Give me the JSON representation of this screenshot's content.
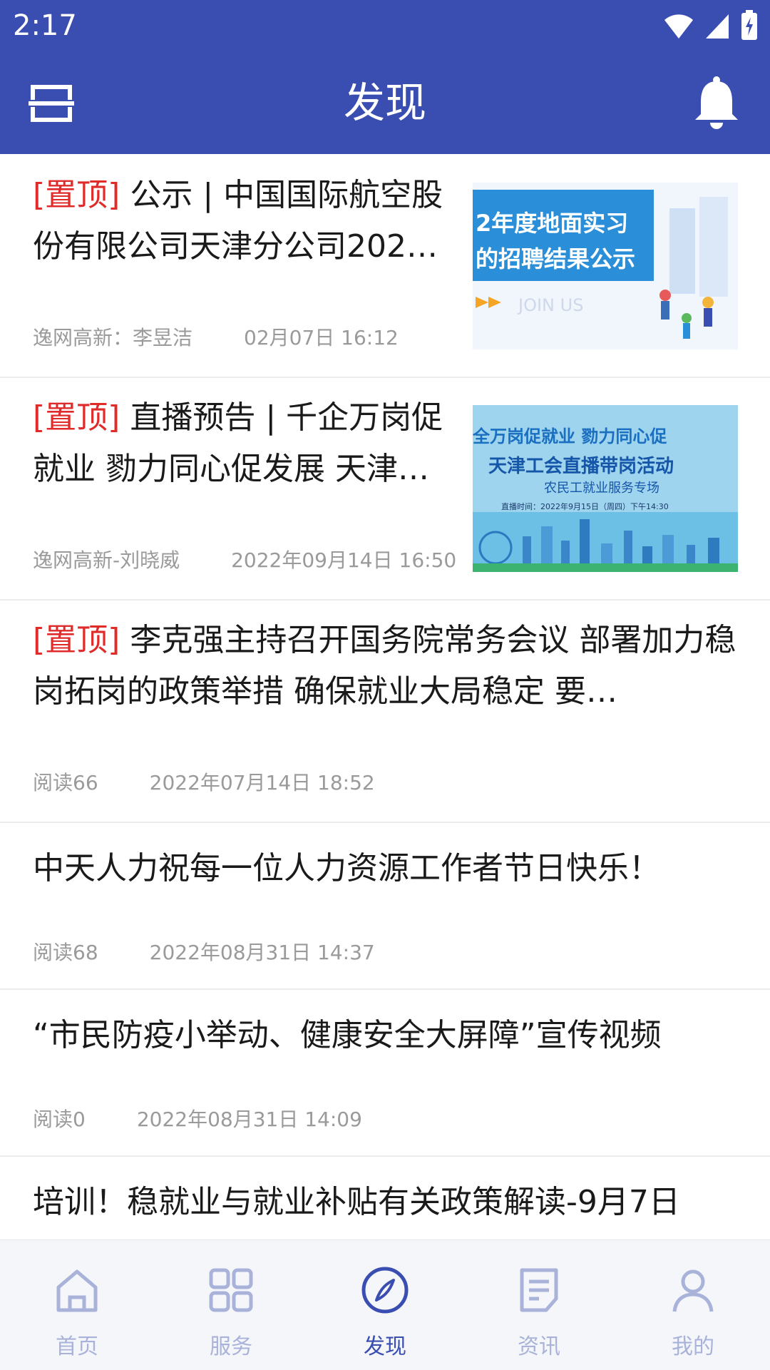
{
  "status_bar": {
    "time": "2:17"
  },
  "app_bar": {
    "title": "发现"
  },
  "feed": [
    {
      "pin": "[置顶]",
      "title": "公示 | 中国国际航空股份有限公司天津分公司202…",
      "author": "逸网高新：李昱洁",
      "date": "02月07日 16:12",
      "thumb": {
        "line1": "2年度地面实习",
        "line2": "的招聘结果公示",
        "line3": "JOIN US"
      }
    },
    {
      "pin": "[置顶]",
      "title": "直播预告 | 千企万岗促就业 勠力同心促发展 天津…",
      "author": "逸网高新-刘晓威",
      "date": "2022年09月14日 16:50",
      "thumb": {
        "line1": "全万岗促就业 勠力同心促",
        "line2": "天津工会直播带岗活动",
        "line3": "农民工就业服务专场",
        "line4": "直播时间：2022年9月15日（周四）下午14:30"
      }
    },
    {
      "pin": "[置顶]",
      "title": "李克强主持召开国务院常务会议 部署加力稳岗拓岗的政策举措 确保就业大局稳定 要…",
      "author": "阅读66",
      "date": "2022年07月14日 18:52"
    },
    {
      "title": "中天人力祝每一位人力资源工作者节日快乐！",
      "author": "阅读68",
      "date": "2022年08月31日 14:37"
    },
    {
      "title": "“市民防疫小举动、健康安全大屏障”宣传视频",
      "author": "阅读0",
      "date": "2022年08月31日 14:09"
    },
    {
      "title": "培训！稳就业与就业补贴有关政策解读-9月7日"
    }
  ],
  "tabs": [
    {
      "label": "首页",
      "icon": "home-icon"
    },
    {
      "label": "服务",
      "icon": "grid-icon"
    },
    {
      "label": "发现",
      "icon": "compass-icon",
      "active": true
    },
    {
      "label": "资讯",
      "icon": "news-icon"
    },
    {
      "label": "我的",
      "icon": "person-icon"
    }
  ],
  "colors": {
    "brand": "#3a4db1",
    "pin": "#e02b2b",
    "tab_inactive": "#a9b3da"
  }
}
